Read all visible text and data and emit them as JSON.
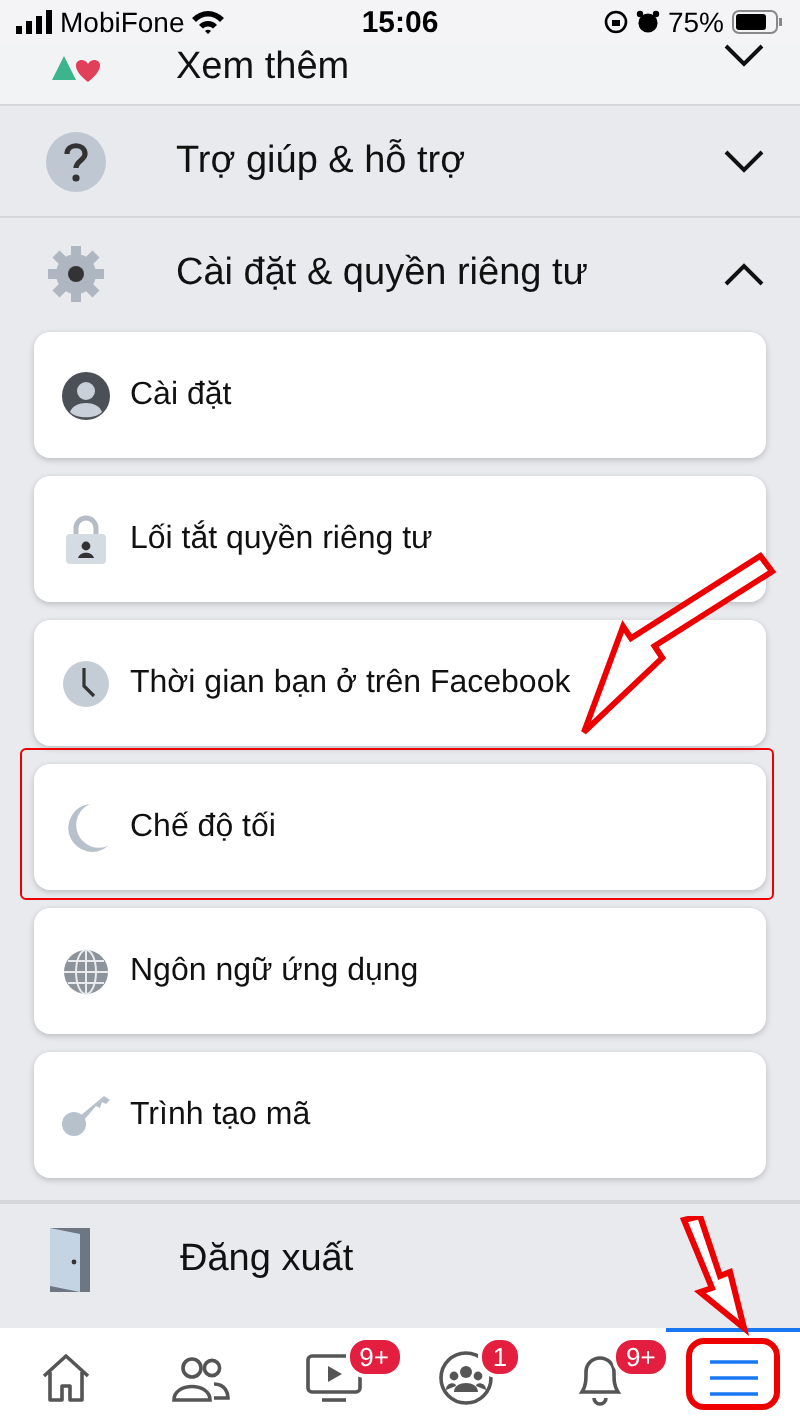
{
  "status_bar": {
    "carrier": "MobiFone",
    "time": "15:06",
    "battery": "75%"
  },
  "sections": [
    {
      "label": "Xem thêm",
      "expanded": false
    },
    {
      "label": "Trợ giúp & hỗ trợ",
      "expanded": false
    },
    {
      "label": "Cài đặt & quyền riêng tư",
      "expanded": true,
      "items": [
        {
          "label": "Cài đặt"
        },
        {
          "label": "Lối tắt quyền riêng tư"
        },
        {
          "label": "Thời gian bạn ở trên Facebook"
        },
        {
          "label": "Chế độ tối",
          "highlighted": true
        },
        {
          "label": "Ngôn ngữ ứng dụng"
        },
        {
          "label": "Trình tạo mã"
        }
      ]
    }
  ],
  "logout": {
    "label": "Đăng xuất"
  },
  "tabs": [
    {
      "selected": false
    },
    {
      "selected": false
    },
    {
      "badge": "9+",
      "selected": false
    },
    {
      "badge": "1",
      "selected": false
    },
    {
      "badge": "9+",
      "selected": false
    },
    {
      "selected": true,
      "highlighted": true
    }
  ]
}
